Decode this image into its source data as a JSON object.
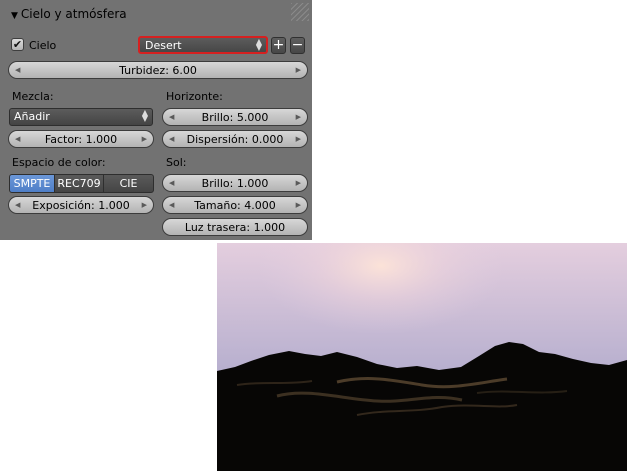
{
  "panel": {
    "title": "Cielo y atmósfera",
    "sky_checkbox": {
      "label": "Cielo",
      "checked": true
    },
    "preset": {
      "value": "Desert",
      "add": "+",
      "remove": "−"
    },
    "turbidity": "Turbidez: 6.00",
    "mix_label": "Mezcla:",
    "mix_mode": "Añadir",
    "factor": "Factor: 1.000",
    "horizon_label": "Horizonte:",
    "horizon_brightness": "Brillo: 5.000",
    "horizon_spread": "Dispersión: 0.000",
    "color_space_label": "Espacio de color:",
    "color_spaces": [
      "SMPTE",
      "REC709",
      "CIE"
    ],
    "selected_color_space": "SMPTE",
    "exposure": "Exposición: 1.000",
    "sun_label": "Sol:",
    "sun_brightness": "Brillo: 1.000",
    "sun_size": "Tamaño: 4.000",
    "back_light": "Luz trasera: 1.000"
  },
  "colors": {
    "panel_bg": "#727272",
    "highlight_border": "#d62020",
    "active_segment": "#5a8ad0"
  },
  "icons": {
    "collapse": "triangle-down-icon",
    "spinner": "up-down-arrows-icon",
    "check": "check-icon"
  }
}
